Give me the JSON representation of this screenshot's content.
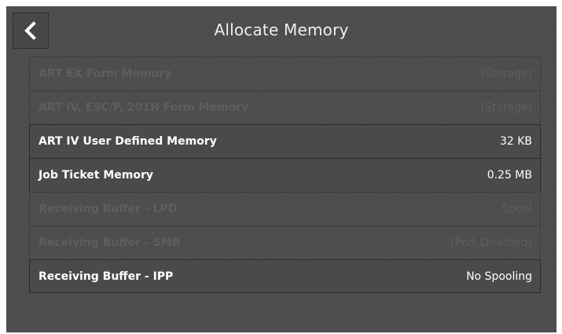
{
  "header": {
    "title": "Allocate Memory",
    "back_icon": "chevron-left-icon"
  },
  "items": [
    {
      "label": "ART EX Form Memory",
      "value": "(Storage)",
      "enabled": false
    },
    {
      "label": "ART IV, ESC/P, 201H Form Memory",
      "value": "(Storage)",
      "enabled": false
    },
    {
      "label": "ART IV User Defined Memory",
      "value": "32 KB",
      "enabled": true
    },
    {
      "label": "Job Ticket Memory",
      "value": "0.25 MB",
      "enabled": true
    },
    {
      "label": "Receiving Buffer - LPD",
      "value": "Spool",
      "enabled": false
    },
    {
      "label": "Receiving Buffer - SMB",
      "value": "(Port Disabled)",
      "enabled": false
    },
    {
      "label": "Receiving Buffer - IPP",
      "value": "No Spooling",
      "enabled": true
    }
  ],
  "colors": {
    "background": "#4c4c4c",
    "text_enabled": "#ffffff",
    "text_disabled": "#5e5e5e"
  }
}
